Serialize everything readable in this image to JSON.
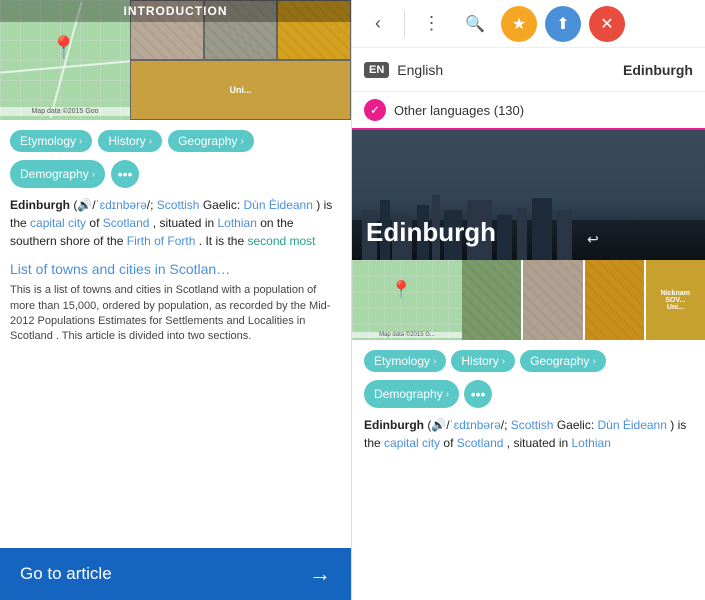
{
  "left": {
    "header_label": "INTRODUCTION",
    "map_label": "Map data ©2015 Goo",
    "chips": [
      {
        "label": "Etymology",
        "arrow": "›"
      },
      {
        "label": "History",
        "arrow": "›"
      },
      {
        "label": "Geography",
        "arrow": "›"
      },
      {
        "label": "Demography",
        "arrow": "›"
      }
    ],
    "more_label": "•••",
    "article_intro": "Edinburgh",
    "article_phonetic": " (🔊/ˈɛdɪnbərə/; ",
    "article_scottish_label": "Scottish",
    "article_gaelic": " Gaelic: ",
    "article_dun": "Dùn Èideann",
    "article_rest": ") is the ",
    "article_capital": "capital city",
    "article_of": " of ",
    "article_scotland": "Scotland",
    "article_situated": ", situated in ",
    "article_lothian": "Lothian",
    "article_shore": " on the southern shore of the ",
    "article_firth": "Firth of Forth",
    "article_it": ". It is the ",
    "article_second": "second most",
    "section_title": "List of towns and cities in Scotlan…",
    "section_body": "This is a list of towns and cities in Scotland with a population of more than 15,000, ordered by population, as recorded by the Mid-2012 Populations Estimates for Settlements and Localities in Scotland .\nThis article is divided into two sections.",
    "go_to_article_label": "Go to article",
    "go_arrow": "→"
  },
  "right": {
    "toolbar": {
      "back_icon": "‹",
      "menu_icon": "⋮",
      "search_icon": "🔍",
      "star_icon": "★",
      "share_icon": "⬆",
      "close_icon": "✕"
    },
    "lang_badge": "EN",
    "lang_name": "English",
    "article_name": "Edinburgh",
    "other_languages_label": "Other languages (130)",
    "other_lang_check": "✓",
    "hero_title": "Edinburgh",
    "hero_share": "⬅",
    "map_label": "Map data ©2015 G...",
    "chips": [
      {
        "label": "Etymology",
        "arrow": "›"
      },
      {
        "label": "History",
        "arrow": "›"
      },
      {
        "label": "Geography",
        "arrow": "›"
      },
      {
        "label": "Demography",
        "arrow": "›"
      }
    ],
    "more_label": "•••",
    "article_intro": "Edinburgh",
    "article_phonetic": " (🔊/ˈɛdɪnbərə/; ",
    "article_scottish_label": "Scottish",
    "article_gaelic": " Gaelic: ",
    "article_dun": "Dùn Èideann",
    "article_rest": ") is the ",
    "article_capital": "capital",
    "article_city_text": "city",
    "article_of_text": " of ",
    "nicknam_label": "Nicknam SOV... Uni..."
  }
}
